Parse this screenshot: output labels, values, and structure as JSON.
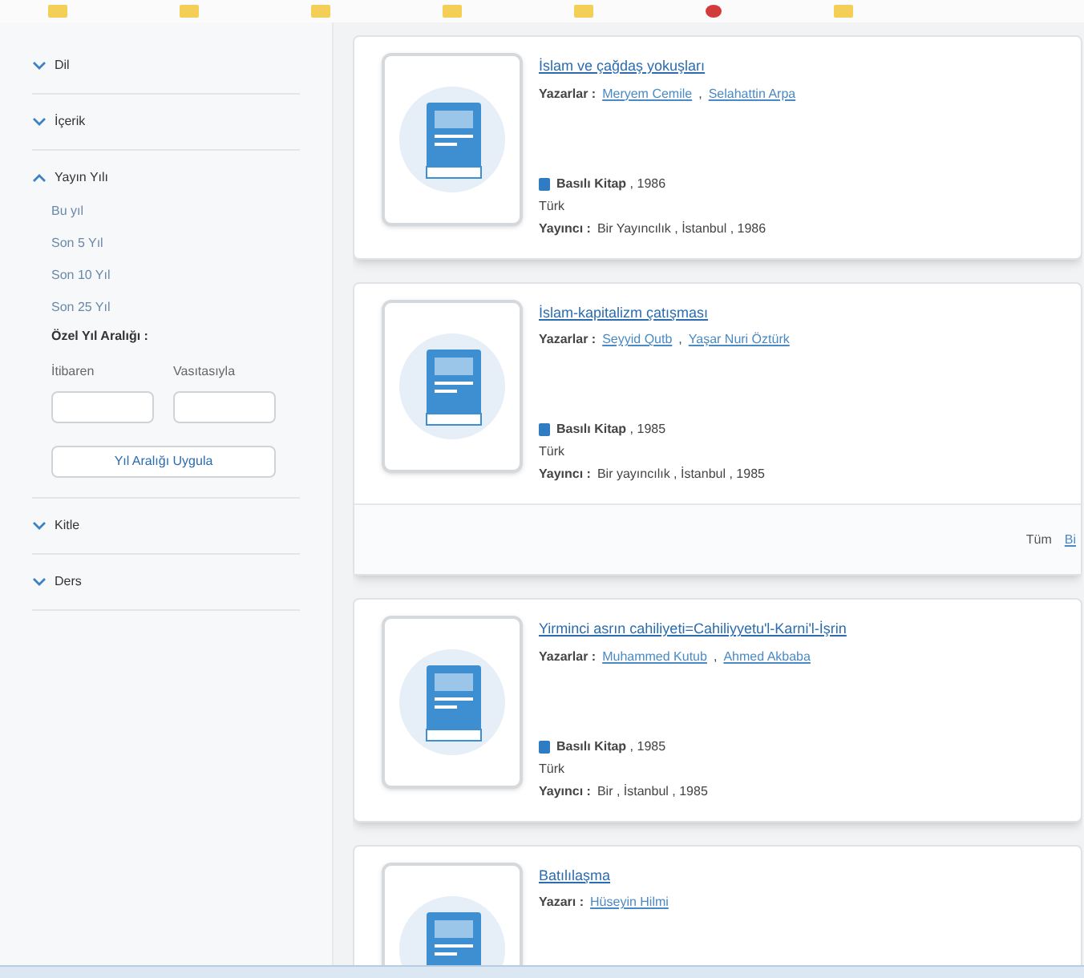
{
  "bookmark_bar": {
    "items": [
      {
        "kind": "folder"
      },
      {
        "kind": "folder"
      },
      {
        "kind": "folder"
      },
      {
        "kind": "folder"
      },
      {
        "kind": "folder"
      },
      {
        "kind": "site"
      },
      {
        "kind": "folder"
      }
    ]
  },
  "filters": [
    {
      "label": "Dil",
      "expanded": false
    },
    {
      "label": "İçerik",
      "expanded": false
    },
    {
      "label": "Yayın Yılı",
      "expanded": true,
      "options": [
        "Bu yıl",
        "Son 5 Yıl",
        "Son 10 Yıl",
        "Son 25 Yıl"
      ],
      "custom_range": {
        "label": "Özel Yıl Aralığı :",
        "from_label": "İtibaren",
        "to_label": "Vasıtasıyla",
        "apply_button": "Yıl Aralığı Uygula"
      }
    },
    {
      "label": "Kitle",
      "expanded": false
    },
    {
      "label": "Ders",
      "expanded": false
    }
  ],
  "results": [
    {
      "title": "İslam ve çağdaş yokuşları",
      "author_label": "Yazarlar :",
      "author_separator": ",",
      "authors": [
        "Meryem Cemile",
        "Selahattin Arpa"
      ],
      "format": "Basılı Kitap",
      "year": " , 1986",
      "language": "Türk",
      "publisher_label": "Yayıncı :",
      "publisher": "Bir Yayıncılık , İstanbul , 1986"
    },
    {
      "title": "İslam-kapitalizm çatışması",
      "author_label": "Yazarlar :",
      "author_separator": ",",
      "authors": [
        "Seyyid Qutb",
        "Yaşar Nuri Öztürk"
      ],
      "format": "Basılı Kitap",
      "year": " , 1985",
      "language": "Türk",
      "publisher_label": "Yayıncı :",
      "publisher": "Bir yayıncılık , İstanbul , 1985",
      "footer": {
        "text": "Tüm",
        "link": "Bi"
      }
    },
    {
      "title": "Yirminci asrın cahiliyeti=Cahiliyyetu'l-Karni'l-İşrin",
      "author_label": "Yazarlar :",
      "author_separator": ",",
      "authors": [
        "Muhammed Kutub",
        "Ahmed Akbaba"
      ],
      "format": "Basılı Kitap",
      "year": " , 1985",
      "language": "Türk",
      "publisher_label": "Yayıncı :",
      "publisher": "Bir , İstanbul , 1985"
    },
    {
      "title": "Batılılaşma",
      "author_label": "Yazarı :",
      "authors": [
        "Hüseyin Hilmi"
      ]
    }
  ]
}
